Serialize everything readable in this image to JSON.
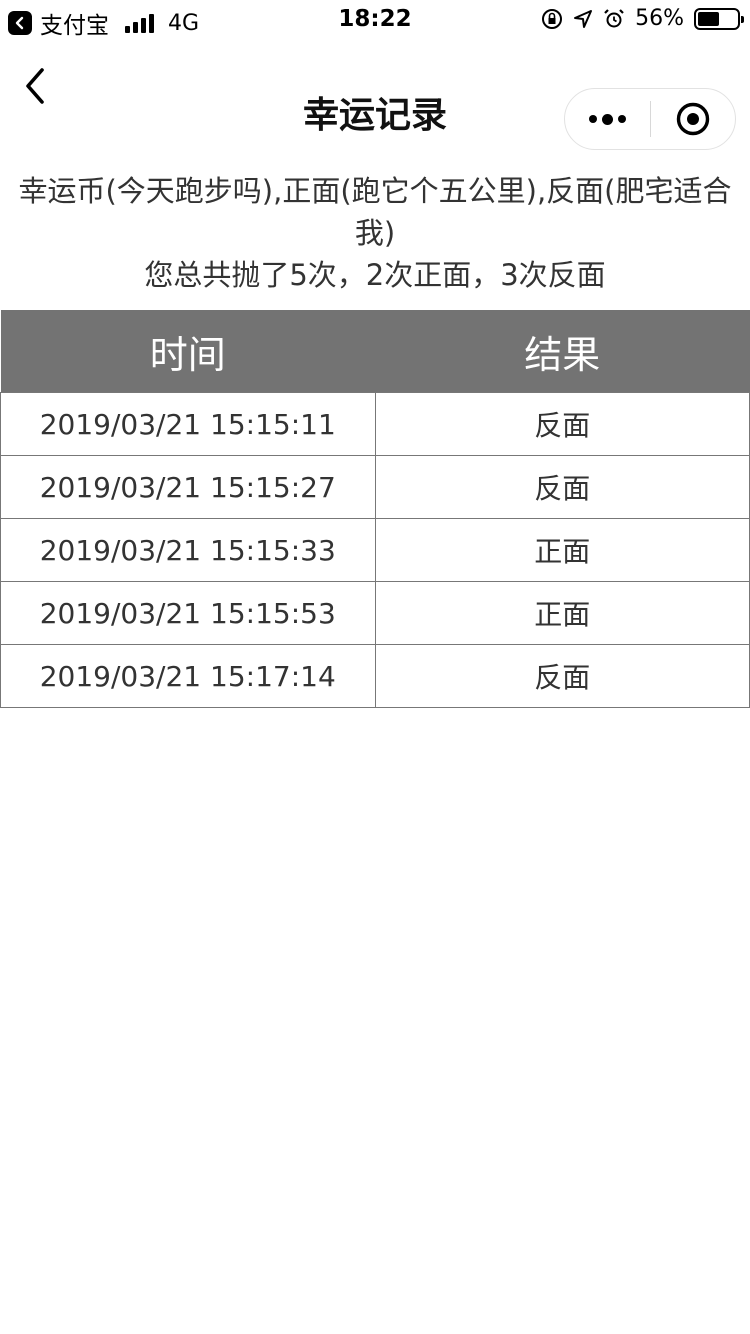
{
  "status_bar": {
    "app": "支付宝",
    "network": "4G",
    "time": "18:22",
    "battery": "56%",
    "battery_level": 0.56
  },
  "nav": {
    "title": "幸运记录"
  },
  "intro": "幸运币(今天跑步吗),正面(跑它个五公里),反面(肥宅适合我)",
  "summary": "您总共抛了5次，2次正面，3次反面",
  "table": {
    "headers": [
      "时间",
      "结果"
    ],
    "rows": [
      [
        "2019/03/21 15:15:11",
        "反面"
      ],
      [
        "2019/03/21 15:15:27",
        "反面"
      ],
      [
        "2019/03/21 15:15:33",
        "正面"
      ],
      [
        "2019/03/21 15:15:53",
        "正面"
      ],
      [
        "2019/03/21 15:17:14",
        "反面"
      ]
    ]
  },
  "icons": {
    "back": "chevron-left-icon",
    "more": "more-dots-icon",
    "close": "target-circle-icon",
    "lock": "orientation-lock-icon",
    "location": "location-arrow-icon",
    "alarm": "alarm-icon"
  }
}
